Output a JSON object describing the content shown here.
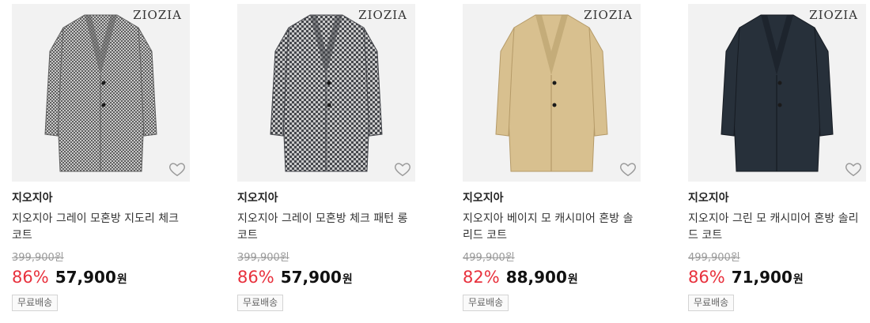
{
  "products": [
    {
      "logo": "ZIOZIA",
      "brand": "지오지아",
      "name": "지오지아 그레이 모혼방 지도리 체크 코트",
      "original_price": "399,900원",
      "discount": "86%",
      "price": "57,900",
      "currency": "원",
      "badge": "무료배송",
      "coat_color": "#8f8f8f",
      "coat_dark": "#5f5f5f",
      "pattern": "houndstooth"
    },
    {
      "logo": "ZIOZIA",
      "brand": "지오지아",
      "name": "지오지아 그레이 모혼방 체크 패턴 롱 코트",
      "original_price": "399,900원",
      "discount": "86%",
      "price": "57,900",
      "currency": "원",
      "badge": "무료배송",
      "coat_color": "#7d7f84",
      "coat_dark": "#45474c",
      "pattern": "glen-check"
    },
    {
      "logo": "ZIOZIA",
      "brand": "지오지아",
      "name": "지오지아 베이지 모 캐시미어 혼방 솔리드 코트",
      "original_price": "499,900원",
      "discount": "82%",
      "price": "88,900",
      "currency": "원",
      "badge": "무료배송",
      "coat_color": "#d8c08f",
      "coat_dark": "#b59a68",
      "pattern": "solid"
    },
    {
      "logo": "ZIOZIA",
      "brand": "지오지아",
      "name": "지오지아 그린 모 캐시미어 혼방 솔리드 코트",
      "original_price": "499,900원",
      "discount": "86%",
      "price": "71,900",
      "currency": "원",
      "badge": "무료배송",
      "coat_color": "#27303a",
      "coat_dark": "#161b22",
      "pattern": "solid"
    }
  ],
  "icons": {
    "wishlist": "heart-outline-icon"
  },
  "colors": {
    "discount": "#e8313d",
    "thumb_bg": "#f2f2f2"
  }
}
